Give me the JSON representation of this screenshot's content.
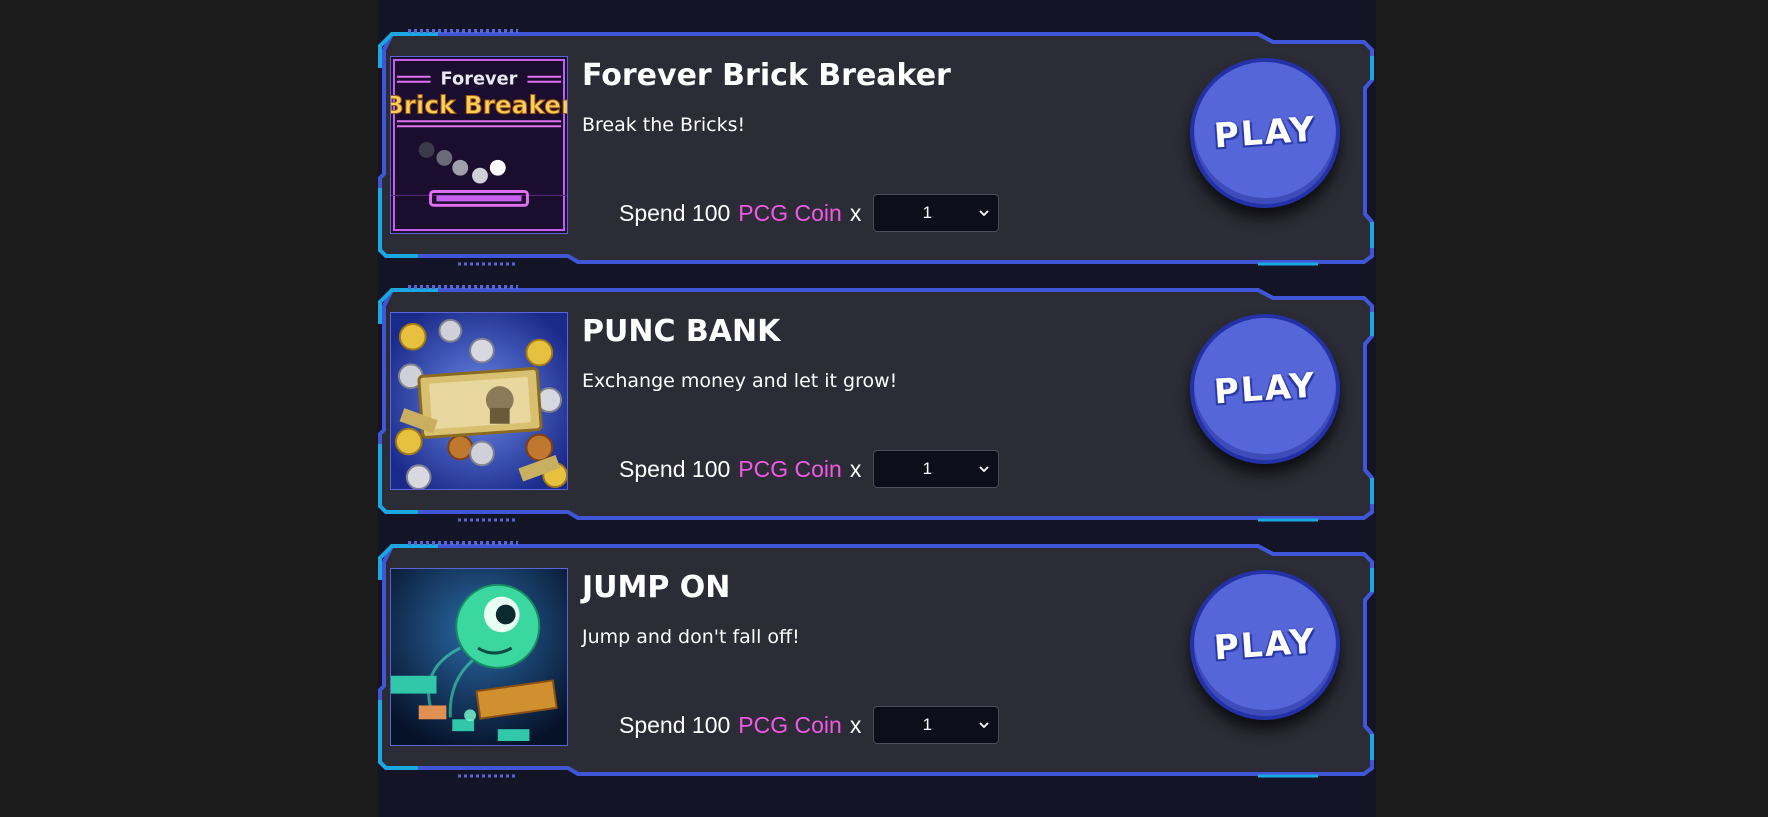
{
  "games": [
    {
      "title": "Forever Brick Breaker",
      "description": "Break the Bricks!",
      "spend_prefix": "Spend 100",
      "coin_label": "PCG Coin",
      "multiplier": "x",
      "quantity": "1",
      "play_label": "PLAY",
      "thumb_text_top": "Forever",
      "thumb_text_main": "Brick Breaker"
    },
    {
      "title": "PUNC BANK",
      "description": "Exchange money and let it grow!",
      "spend_prefix": "Spend 100",
      "coin_label": "PCG Coin",
      "multiplier": "x",
      "quantity": "1",
      "play_label": "PLAY"
    },
    {
      "title": "JUMP ON",
      "description": "Jump and don't fall off!",
      "spend_prefix": "Spend 100",
      "coin_label": "PCG Coin",
      "multiplier": "x",
      "quantity": "1",
      "play_label": "PLAY"
    }
  ],
  "colors": {
    "page_bg": "#1b1b1c",
    "column_bg": "#131526",
    "card_bg": "#2b2c36",
    "frame_blue": "#3f56d6",
    "frame_cyan": "#1aa8e0",
    "coin_pink": "#f05ae6",
    "play_fill": "#5566d8"
  }
}
